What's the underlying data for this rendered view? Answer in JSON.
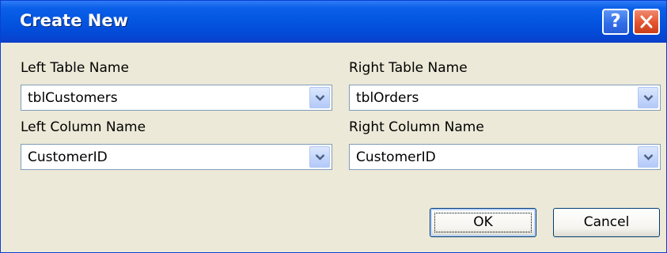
{
  "dialog": {
    "title": "Create New",
    "help_glyph": "?"
  },
  "fields": {
    "left_table": {
      "label": "Left Table Name",
      "value": "tblCustomers"
    },
    "right_table": {
      "label": "Right Table Name",
      "value": "tblOrders"
    },
    "left_column": {
      "label": "Left Column Name",
      "value": "CustomerID"
    },
    "right_column": {
      "label": "Right Column Name",
      "value": "CustomerID"
    }
  },
  "buttons": {
    "ok_label": "OK",
    "cancel_label": "Cancel"
  },
  "colors": {
    "titlebar": "#0355e0",
    "dialog_bg": "#ece9d8",
    "close_button": "#e4542f",
    "help_button": "#2f6ce8",
    "combo_border": "#7f9db9"
  },
  "icons": {
    "help": "help-icon",
    "close": "close-icon",
    "dropdown": "chevron-down-icon"
  }
}
